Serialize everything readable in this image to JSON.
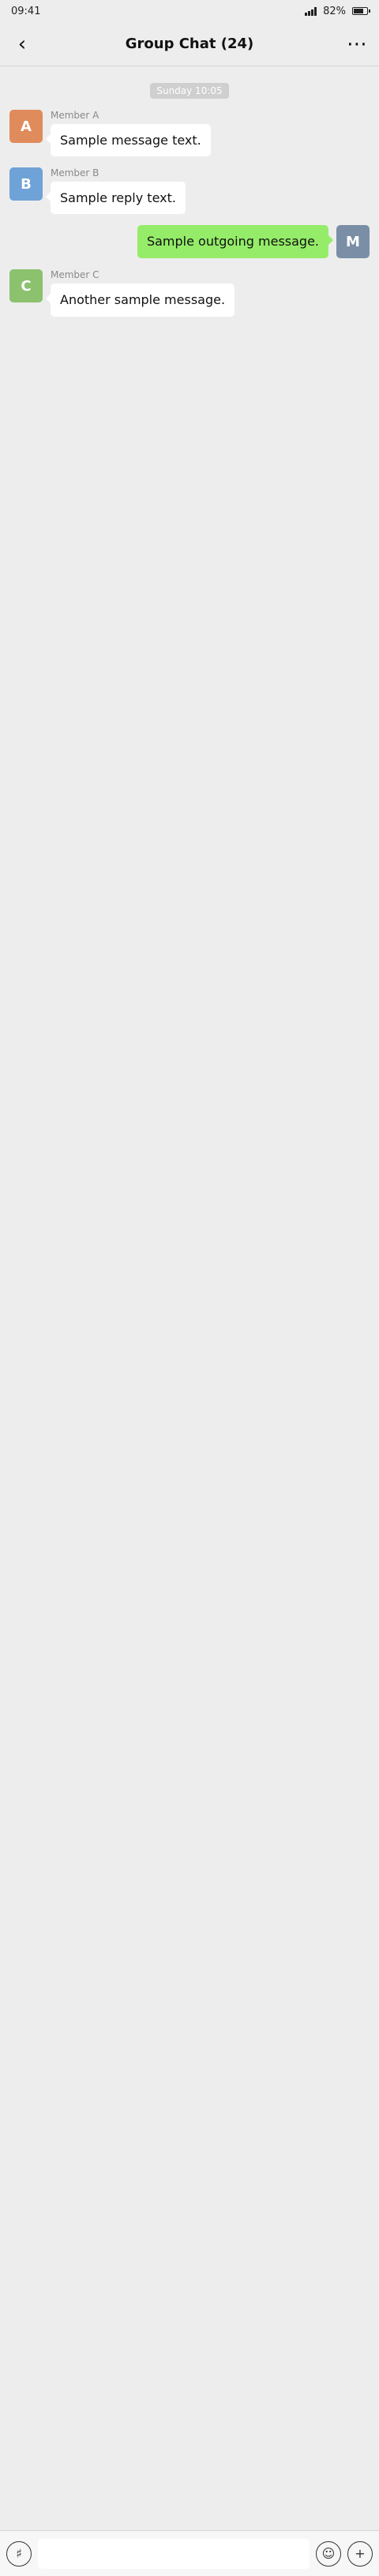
{
  "status_bar": {
    "time": "09:41",
    "battery": "82%",
    "battery_level": 0.82
  },
  "header": {
    "title": "Group Chat (24)"
  },
  "colors": {
    "accent": "#95ec69",
    "avatars": [
      "#e08b5c",
      "#6fa3d8",
      "#8cc26e",
      "#c87dc4"
    ]
  },
  "icons": {
    "back": "back-arrow-icon",
    "more": "more-icon",
    "voice": "voice-icon",
    "emoji": "emoji-icon",
    "plus": "plus-icon"
  },
  "input": {
    "placeholder": ""
  },
  "messages": [
    {
      "type": "time",
      "text": "Sunday 10:05"
    },
    {
      "type": "in",
      "sender": "Member A",
      "avatar_text": "A",
      "avatar_color": 0,
      "text": "Sample message text."
    },
    {
      "type": "in",
      "sender": "Member B",
      "avatar_text": "B",
      "avatar_color": 1,
      "text": "Sample reply text."
    },
    {
      "type": "out",
      "avatar_text": "M",
      "text": "Sample outgoing message."
    },
    {
      "type": "in",
      "sender": "Member C",
      "avatar_text": "C",
      "avatar_color": 2,
      "text": "Another sample message."
    }
  ]
}
